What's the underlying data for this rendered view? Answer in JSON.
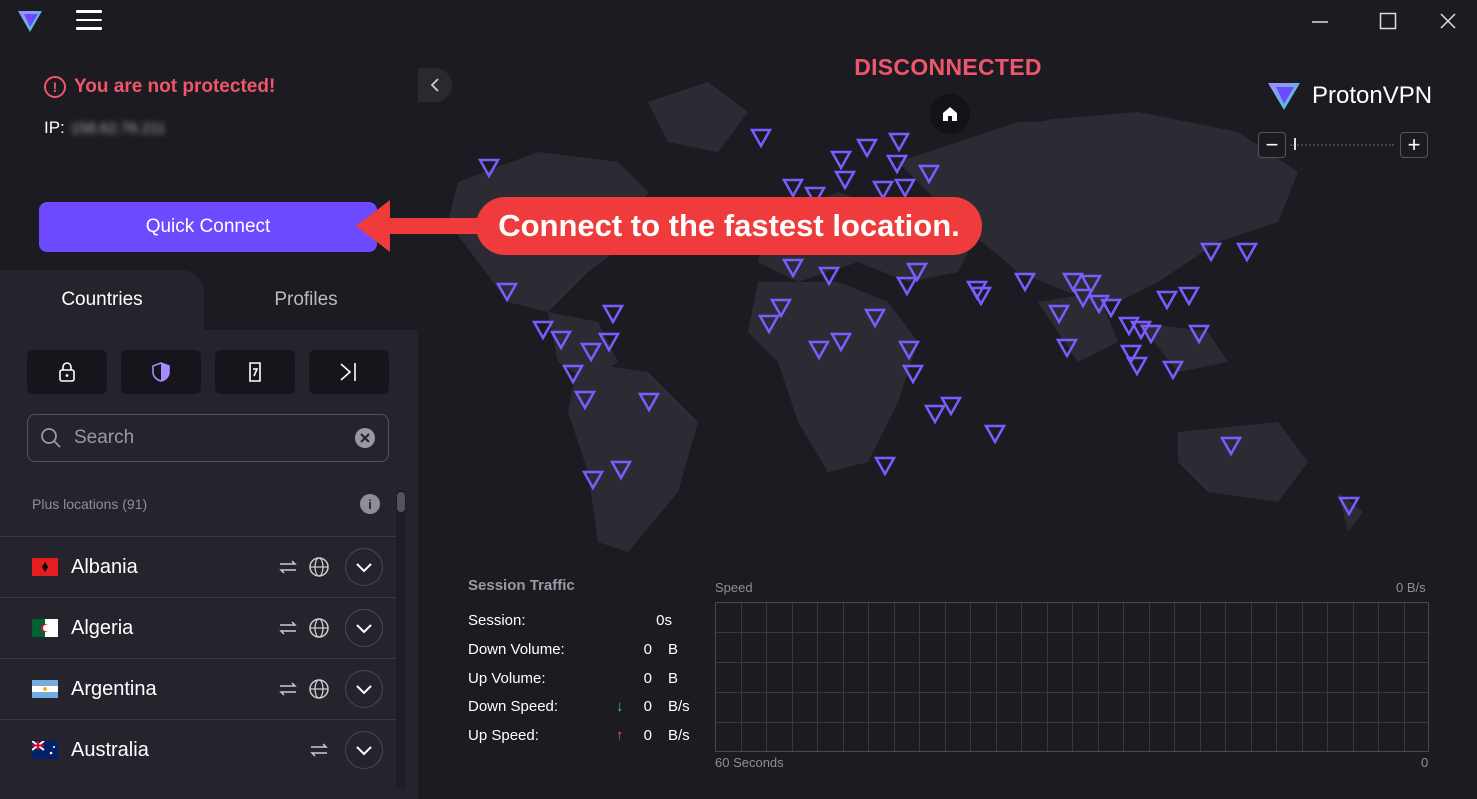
{
  "window": {
    "minimize_icon": "minimize-icon",
    "maximize_icon": "maximize-icon",
    "close_icon": "close-icon"
  },
  "status": {
    "warning": "You are not protected!",
    "ip_label": "IP:",
    "ip_value": "158.62.76.211"
  },
  "quick_connect": {
    "label": "Quick Connect"
  },
  "tabs": [
    {
      "label": "Countries"
    },
    {
      "label": "Profiles"
    }
  ],
  "filters": [
    "lock-icon",
    "shield-icon",
    "document-icon",
    "arrow-right-bar-icon"
  ],
  "search": {
    "placeholder": "Search"
  },
  "locations": {
    "header": "Plus locations (91)",
    "countries": [
      {
        "name": "Albania",
        "flag_colors": [
          "#e41e20",
          "#000000"
        ]
      },
      {
        "name": "Algeria",
        "flag_colors": [
          "#006233",
          "#ffffff",
          "#d21034"
        ]
      },
      {
        "name": "Argentina",
        "flag_colors": [
          "#74acdf",
          "#ffffff"
        ]
      },
      {
        "name": "Australia",
        "flag_colors": [
          "#012169",
          "#ffffff",
          "#e4002b"
        ]
      }
    ]
  },
  "map": {
    "status_text": "DISCONNECTED",
    "brand_name": "Proton",
    "brand_suffix": "VPN",
    "zoom_out": "−",
    "zoom_in": "+"
  },
  "callout": {
    "text": "Connect to the fastest location."
  },
  "session_traffic": {
    "title": "Session Traffic",
    "rows": [
      {
        "label": "Session:",
        "value": "0s",
        "unit": ""
      },
      {
        "label": "Down Volume:",
        "value": "0",
        "unit": "B"
      },
      {
        "label": "Up Volume:",
        "value": "0",
        "unit": "B"
      },
      {
        "label": "Down Speed:",
        "value": "0",
        "unit": "B/s"
      },
      {
        "label": "Up Speed:",
        "value": "0",
        "unit": "B/s"
      }
    ]
  },
  "speed_graph": {
    "label": "Speed",
    "value": "0  B/s",
    "x_label": "60 Seconds",
    "x_end": "0"
  },
  "colors": {
    "accent": "#6d4aff",
    "danger": "#f0566b",
    "callout": "#ef3b3b",
    "server_marker": "#7b5cff"
  }
}
